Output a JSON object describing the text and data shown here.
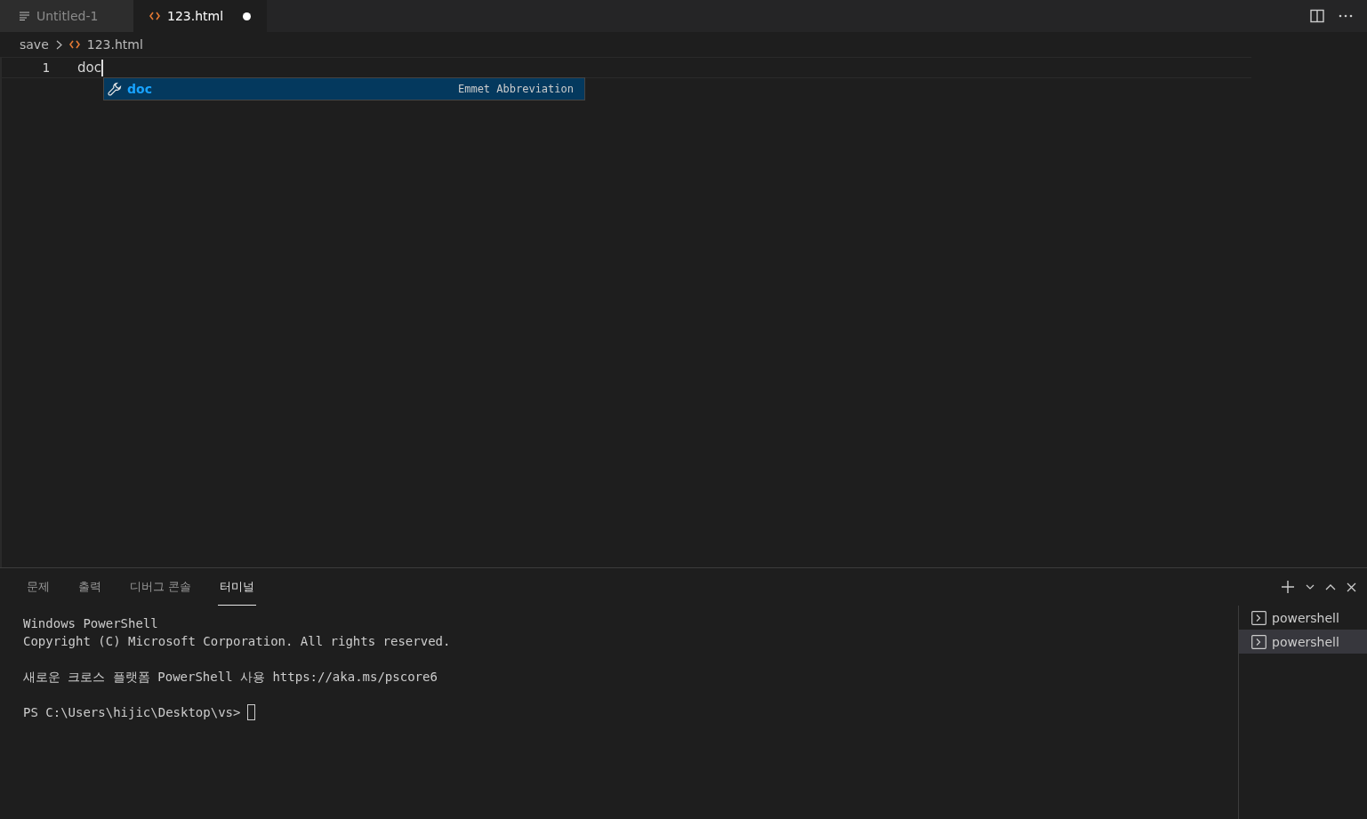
{
  "tabs": [
    {
      "label": "Untitled-1",
      "kind": "text",
      "selected": false,
      "dirty": false
    },
    {
      "label": "123.html",
      "kind": "html",
      "selected": true,
      "dirty": true
    }
  ],
  "breadcrumb": [
    {
      "label": "save",
      "kind": "folder"
    },
    {
      "label": "123.html",
      "kind": "html"
    }
  ],
  "editor": {
    "lines": [
      {
        "number": "1",
        "text": "doc"
      }
    ],
    "suggestions": [
      {
        "label": "doc",
        "detail": "Emmet Abbreviation",
        "selected": true
      }
    ]
  },
  "panel": {
    "tabs": [
      {
        "label": "문제",
        "selected": false
      },
      {
        "label": "출력",
        "selected": false
      },
      {
        "label": "디버그 콘솔",
        "selected": false
      },
      {
        "label": "터미널",
        "selected": true
      }
    ],
    "terminal": {
      "paragraphs": [
        [
          "Windows PowerShell",
          "Copyright (C) Microsoft Corporation. All rights reserved."
        ],
        [
          "새로운 크로스 플랫폼 PowerShell 사용 https://aka.ms/pscore6"
        ]
      ],
      "prompt": "PS C:\\Users\\hijic\\Desktop\\vs>"
    },
    "instances": [
      {
        "label": "powershell",
        "selected": false
      },
      {
        "label": "powershell",
        "selected": true
      }
    ]
  }
}
